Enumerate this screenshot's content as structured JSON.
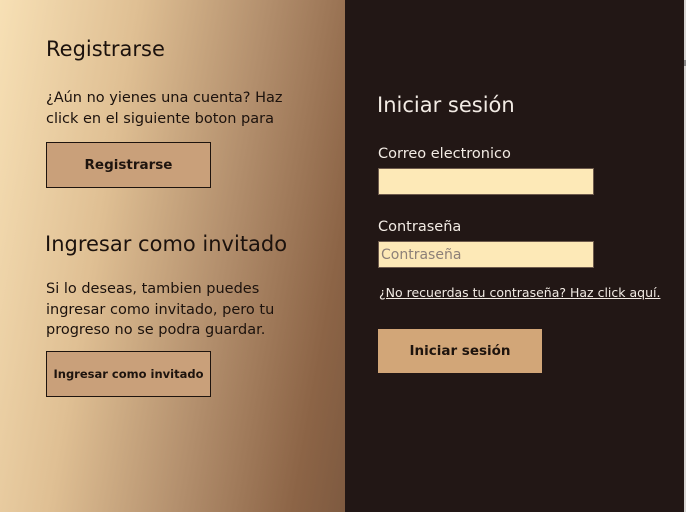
{
  "register": {
    "title": "Registrarse",
    "description": "¿Aún no yienes una cuenta? Haz\nclick en el siguiente boton para",
    "button_label": "Registrarse"
  },
  "guest": {
    "title": "Ingresar como invitado",
    "description": "Si lo deseas, tambien puedes\ningresar como invitado, pero tu\nprogreso no se podra guardar.",
    "button_label": "Ingresar como invitado"
  },
  "login": {
    "title": "Iniciar sesión",
    "email_label": "Correo electronico",
    "email_value": "",
    "password_label": "Contraseña",
    "password_placeholder": "Contraseña",
    "forgot_link": "¿No recuerdas tu contraseña? Haz click aquí.",
    "button_label": "Iniciar sesión"
  },
  "colors": {
    "left_panel_gradient_start": "#f7e0b5",
    "left_panel_gradient_end": "#7e5a40",
    "right_panel_background": "#221715",
    "input_background": "#fde9b7",
    "button_background": "#c9a07a",
    "login_button_background": "#d2a678"
  }
}
